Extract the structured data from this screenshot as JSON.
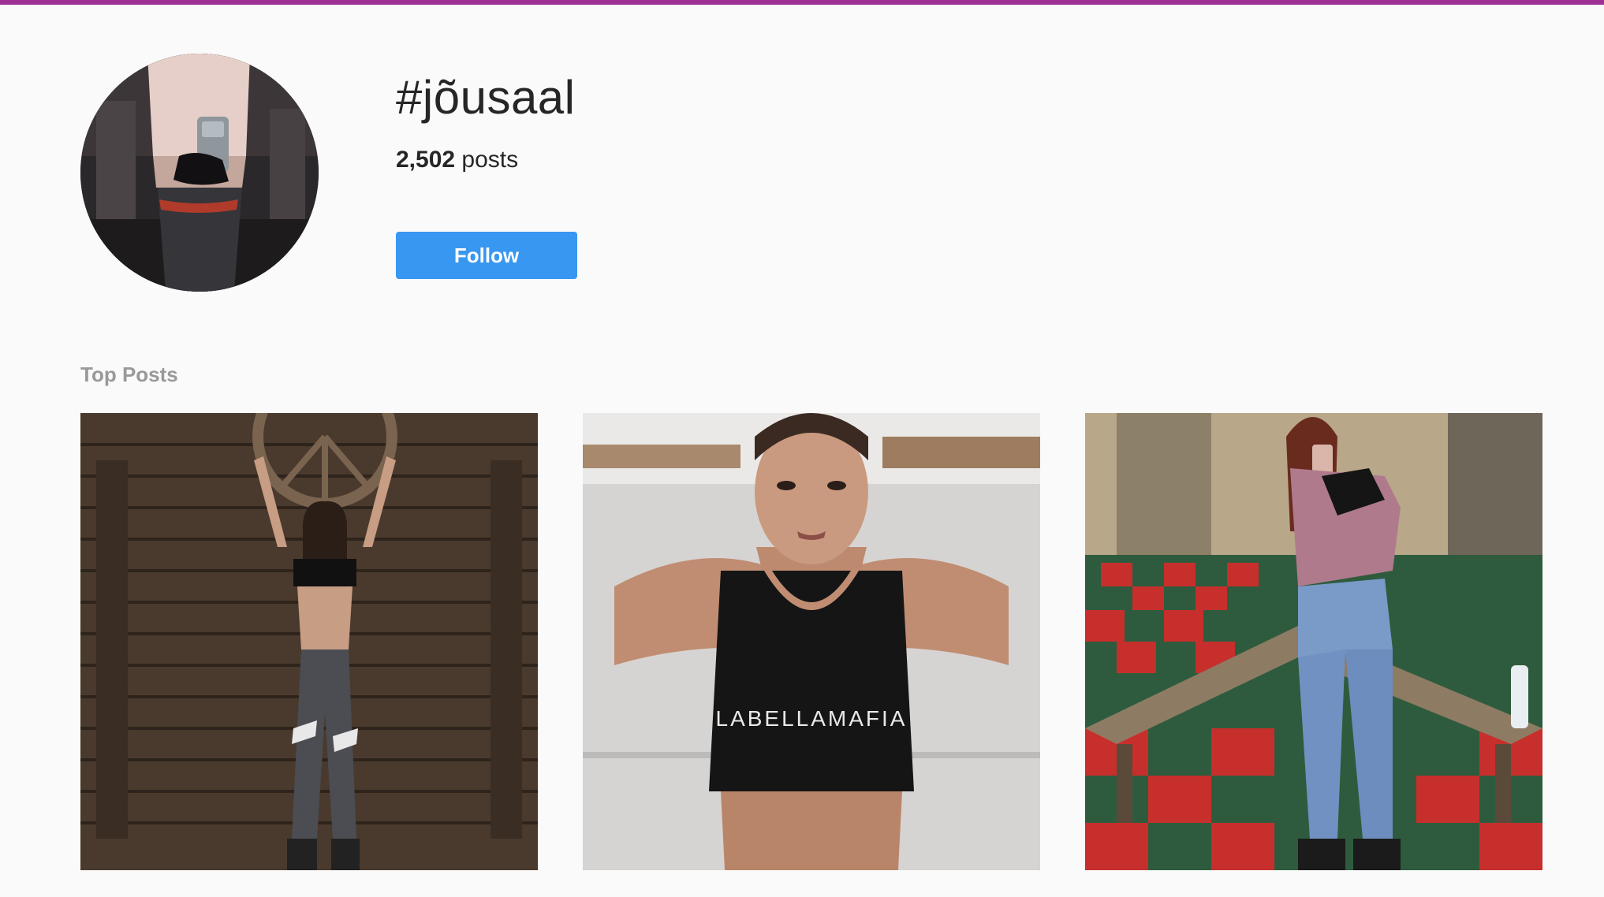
{
  "colors": {
    "top_bar": "#9e2f95",
    "follow_button": "#3897f0",
    "page_background": "#fafafa"
  },
  "hashtag": {
    "title": "#jõusaal",
    "post_count_number": "2,502",
    "post_count_label": "posts",
    "follow_label": "Follow"
  },
  "sections": {
    "top_posts_title": "Top Posts"
  },
  "top_posts": [
    {
      "content": "woman-on-wood-wall-photo",
      "printed_text": ""
    },
    {
      "content": "woman-in-sports-bra-photo",
      "printed_text": "LABELLAMAFIA"
    },
    {
      "content": "woman-gym-mirror-selfie-photo",
      "printed_text": ""
    }
  ]
}
